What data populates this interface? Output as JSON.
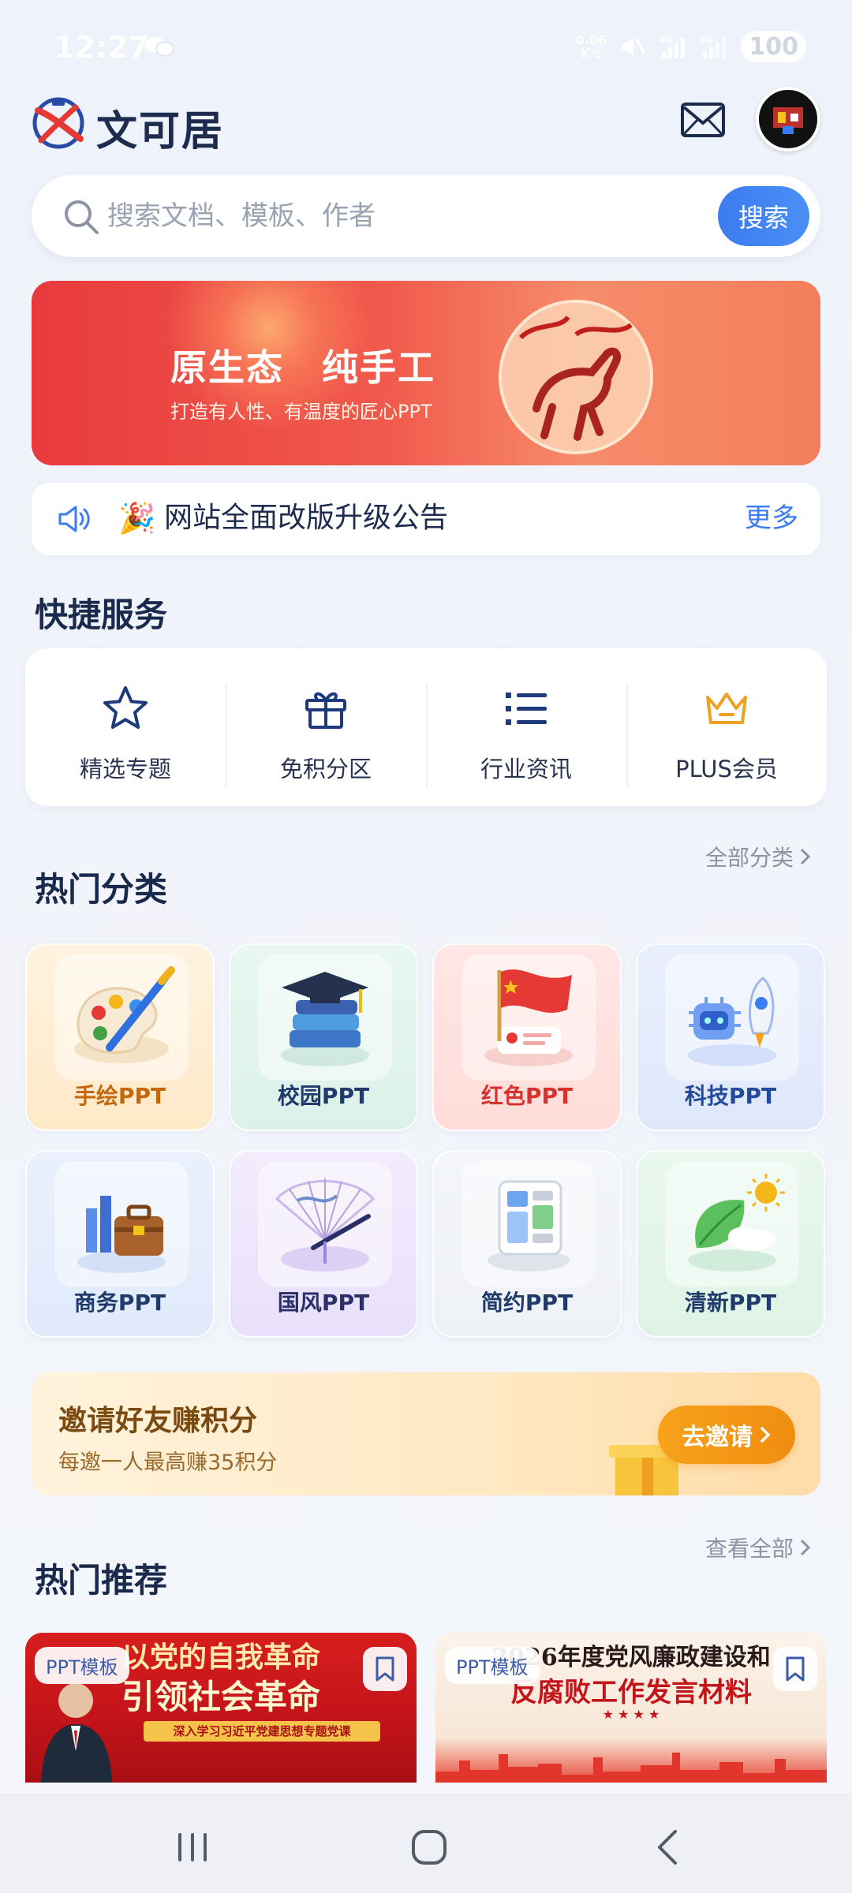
{
  "status_bar": {
    "time": "12:27",
    "net_speed_value": "0.06",
    "net_speed_unit": "K/s",
    "battery": "100",
    "icons": [
      "wechat-icon",
      "mute-icon",
      "signal-4g-icon",
      "signal-5g-icon"
    ]
  },
  "header": {
    "brand": "文可居",
    "icons": [
      "logo-icon",
      "mail-icon",
      "avatar"
    ]
  },
  "search": {
    "placeholder": "搜索文档、模板、作者",
    "button": "搜索"
  },
  "banner": {
    "title": "原生态　纯手工",
    "subtitle": "打造有人性、有温度的匠心PPT"
  },
  "notice": {
    "text": "网站全面改版升级公告",
    "more": "更多"
  },
  "quick_services": {
    "title": "快捷服务",
    "items": [
      {
        "label": "精选专题",
        "icon": "star-icon",
        "color": "#1d3a7a"
      },
      {
        "label": "免积分区",
        "icon": "gift-icon",
        "color": "#1d3a7a"
      },
      {
        "label": "行业资讯",
        "icon": "list-icon",
        "color": "#1d3a7a"
      },
      {
        "label": "PLUS会员",
        "icon": "crown-icon",
        "color": "#f0a020"
      }
    ]
  },
  "categories": {
    "title": "热门分类",
    "all_link": "全部分类",
    "items": [
      {
        "label": "手绘PPT",
        "icon": "palette-icon",
        "color": "#c4680c",
        "bg": "#fff0d6"
      },
      {
        "label": "校园PPT",
        "icon": "graduation-cap-icon",
        "color": "#1f3b6b",
        "bg": "#e3f5ef"
      },
      {
        "label": "红色PPT",
        "icon": "red-flag-icon",
        "color": "#d8322f",
        "bg": "#ffe4e2"
      },
      {
        "label": "科技PPT",
        "icon": "robot-rocket-icon",
        "color": "#244a9a",
        "bg": "#e4ecfc"
      },
      {
        "label": "商务PPT",
        "icon": "briefcase-icon",
        "color": "#1f3b6b",
        "bg": "#e6effd"
      },
      {
        "label": "国风PPT",
        "icon": "fan-icon",
        "color": "#2a2f6a",
        "bg": "#efe8fb"
      },
      {
        "label": "简约PPT",
        "icon": "layout-icon",
        "color": "#1f3b6b",
        "bg": "#f0f3f7"
      },
      {
        "label": "清新PPT",
        "icon": "leaf-sun-icon",
        "color": "#1f3b6b",
        "bg": "#e6f6ee"
      }
    ]
  },
  "invite": {
    "title": "邀请好友赚积分",
    "subtitle": "每邀一人最高赚35积分",
    "button": "去邀请"
  },
  "recommendations": {
    "title": "热门推荐",
    "all_link": "查看全部",
    "items": [
      {
        "tag": "PPT模板",
        "headline_1": "以党的自我革命",
        "headline_2": "引领社会革命",
        "subline": "深入学习习近平党建思想专题党课"
      },
      {
        "tag": "PPT模板",
        "headline_1": "2026年度党风廉政建设和",
        "headline_2": "反腐败工作发言材料",
        "subline": "★ ★ ★ ★"
      }
    ]
  },
  "nav_bar": {
    "buttons": [
      "recent-apps-button",
      "home-button",
      "back-button"
    ]
  }
}
